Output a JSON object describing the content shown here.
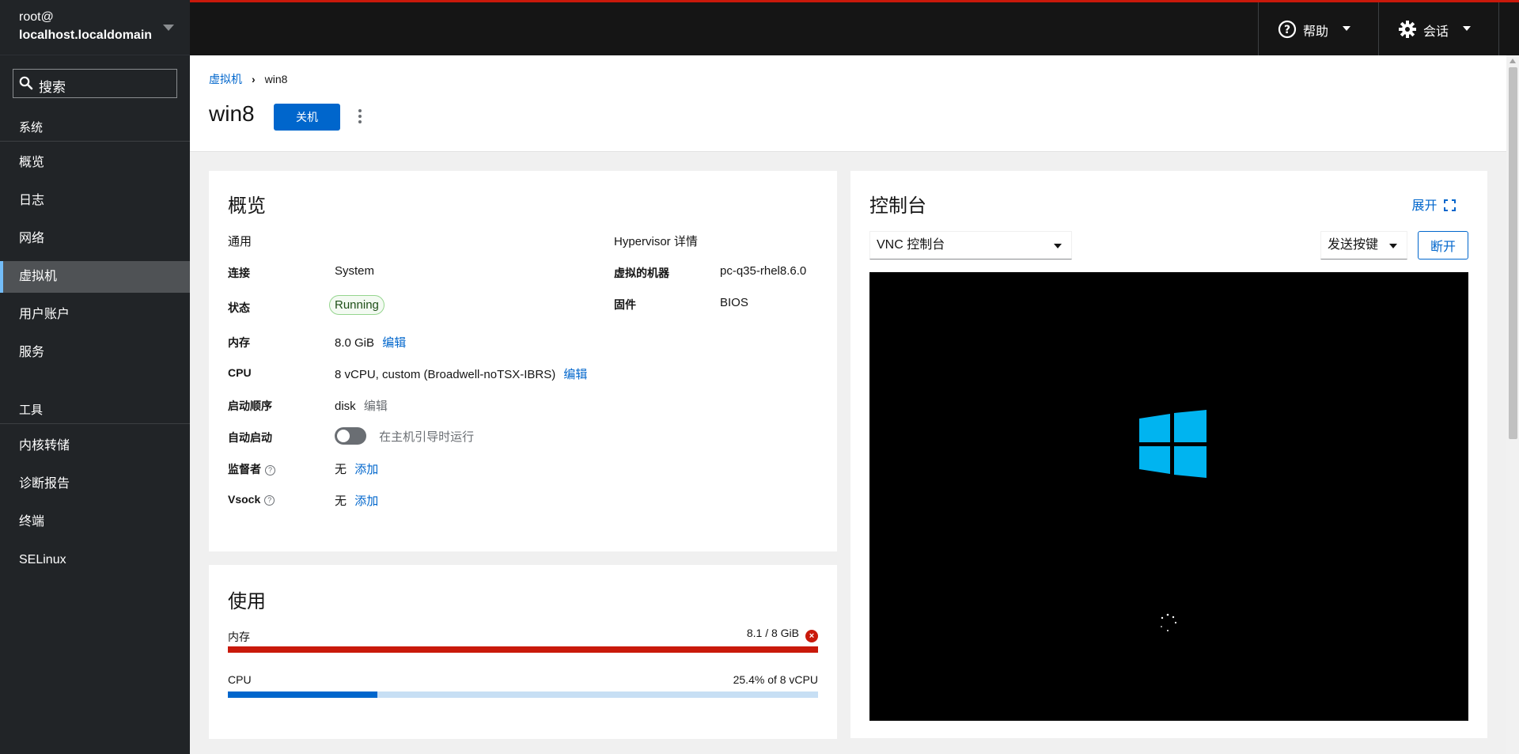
{
  "host": {
    "user": "root@",
    "domain": "localhost.localdomain"
  },
  "search": {
    "placeholder": "搜索"
  },
  "sidebar": {
    "system_title": "系统",
    "system_items": [
      "概览",
      "日志",
      "网络",
      "虚拟机",
      "用户账户",
      "服务"
    ],
    "active_item": "虚拟机",
    "tools_title": "工具",
    "tools_items": [
      "内核转储",
      "诊断报告",
      "终端",
      "SELinux"
    ]
  },
  "topbar": {
    "help": "帮助",
    "session": "会话"
  },
  "breadcrumb": {
    "parent": "虚拟机",
    "current": "win8"
  },
  "vm": {
    "name": "win8",
    "shutdown_label": "关机"
  },
  "overview": {
    "title": "概览",
    "general_title": "通用",
    "hypervisor_title": "Hypervisor 详情",
    "connection_label": "连接",
    "connection_value": "System",
    "state_label": "状态",
    "state_value": "Running",
    "memory_label": "内存",
    "memory_value": "8.0 GiB",
    "cpu_label": "CPU",
    "cpu_value": "8 vCPU, custom (Broadwell-noTSX-IBRS)",
    "boot_label": "启动顺序",
    "boot_value": "disk",
    "autostart_label": "自动启动",
    "autostart_text": "在主机引导时运行",
    "watchdog_label": "监督者",
    "watchdog_value": "无",
    "vsock_label": "Vsock",
    "vsock_value": "无",
    "edit": "编辑",
    "add": "添加",
    "machine_label": "虚拟的机器",
    "machine_value": "pc-q35-rhel8.6.0",
    "firmware_label": "固件",
    "firmware_value": "BIOS"
  },
  "usage": {
    "title": "使用",
    "memory_label": "内存",
    "memory_value": "8.1 / 8 GiB",
    "memory_fraction": 1.0,
    "cpu_label": "CPU",
    "cpu_value": "25.4% of 8 vCPU",
    "cpu_fraction": 0.254
  },
  "console": {
    "title": "控制台",
    "expand": "展开",
    "type": "VNC 控制台",
    "send_keys": "发送按键",
    "disconnect": "断开"
  },
  "colors": {
    "accent": "#0066cc",
    "danger": "#c9190b",
    "logo": "#00b4f0",
    "cpu_bar_bg": "#c7dff4"
  }
}
